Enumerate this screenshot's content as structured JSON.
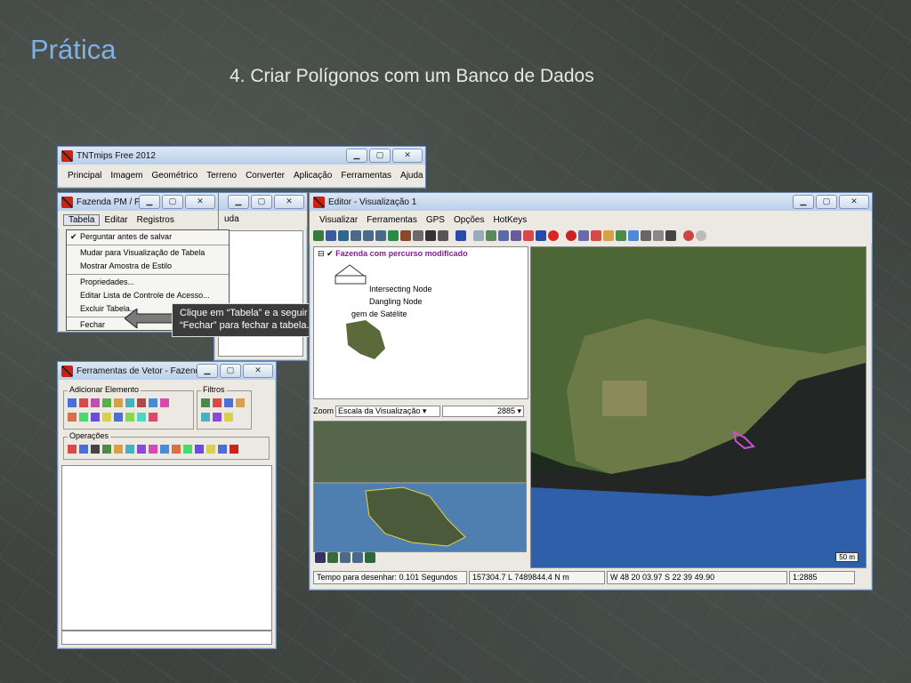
{
  "slide": {
    "title": "Prática",
    "subtitle": "4. Criar Polígonos com um Banco de Dados"
  },
  "main_window": {
    "title": "TNTmips Free 2012",
    "menu": [
      "Principal",
      "Imagem",
      "Geométrico",
      "Terreno",
      "Converter",
      "Aplicação",
      "Ferramentas",
      "Ajuda"
    ]
  },
  "table_window": {
    "title": "Fazenda PM / Po...",
    "menu": [
      "Tabela",
      "Editar",
      "Registros"
    ],
    "menu_extra": "uda"
  },
  "table_menu": {
    "items": [
      {
        "label": "Perguntar antes de salvar",
        "checked": true
      },
      {
        "label": "Mudar para Visualização de Tabela"
      },
      {
        "label": "Mostrar Amostra de Estilo"
      },
      {
        "label": "Propriedades..."
      },
      {
        "label": "Editar Lista de Controle de Acesso..."
      },
      {
        "label": "Excluir Tabela..."
      },
      {
        "label": "Fechar"
      }
    ]
  },
  "callout": {
    "text": "Clique em “Tabela” e a seguir em “Fechar” para fechar a tabela."
  },
  "vector_tools": {
    "title": "Ferramentas de Vetor - Fazenda ...",
    "add_element_label": "Adicionar Elemento",
    "filters_label": "Filtros",
    "operations_label": "Operações"
  },
  "editor": {
    "title": "Editor - Visualização 1",
    "menu": [
      "Visualizar",
      "Ferramentas",
      "GPS",
      "Opções",
      "HotKeys"
    ],
    "layer_name": "Fazenda com percurso modificado",
    "legend": [
      "Intersecting Node",
      "Dangling Node",
      "gem de Satélite"
    ],
    "zoom_label": "Zoom",
    "zoom_mode": "Escala da Visualização",
    "zoom_value": "2885",
    "scale_bar": "50 m",
    "status": {
      "draw_time": "Tempo para desenhar: 0.101 Segundos",
      "coords": "157304.7 L  7489844.4 N m",
      "latlon": "W 48 20 03.97  S 22 39 49.90",
      "scale": "1:2885"
    }
  },
  "colors": {
    "slide_title": "#7fb0e6",
    "titlebar": "#c7d9ef",
    "layer_name": "#8b1a9b",
    "callout_bg": "#3b3b3b"
  }
}
